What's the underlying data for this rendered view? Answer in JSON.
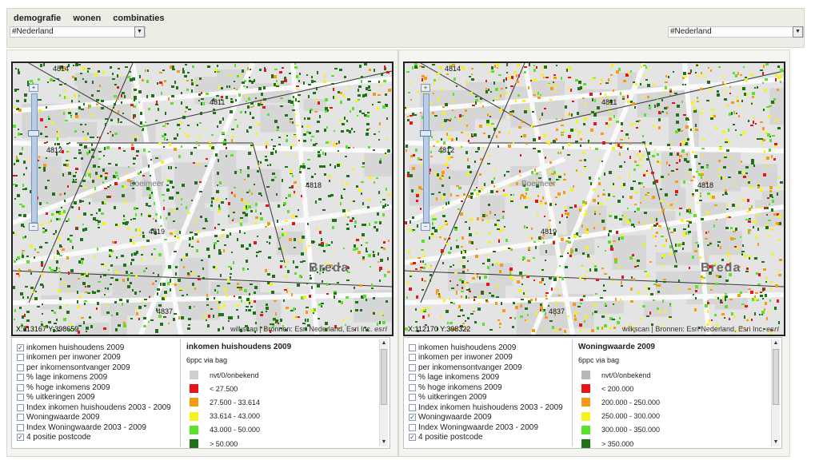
{
  "menu": [
    "demografie",
    "wonen",
    "combinaties"
  ],
  "left_select": "#Nederland",
  "right_select": "#Nederland",
  "left": {
    "coords": "X:113167 Y:398659",
    "attribution": "wilkscan | Bronnen: Esri Nederland, Esri Inc.",
    "esri": "esri",
    "postcodes": [
      "4811",
      "4812",
      "4818",
      "4819",
      "4837",
      "4814"
    ],
    "city": "Breda",
    "district": "Boeimeer",
    "checks": [
      {
        "label": "inkomen huishoudens 2009",
        "checked": true
      },
      {
        "label": "inkomen per inwoner 2009",
        "checked": false
      },
      {
        "label": "per inkomensontvanger 2009",
        "checked": false
      },
      {
        "label": "% lage inkomens 2009",
        "checked": false
      },
      {
        "label": "% hoge inkomens 2009",
        "checked": false
      },
      {
        "label": "% uitkeringen 2009",
        "checked": false
      },
      {
        "label": "Index inkomen huishoudens 2003 - 2009",
        "checked": false
      },
      {
        "label": "Woningwaarde 2009",
        "checked": false
      },
      {
        "label": "Index Woningwaarde 2003 - 2009",
        "checked": false
      },
      {
        "label": "4 positie postcode",
        "checked": true
      }
    ],
    "legend_title": "inkomen huishoudens 2009",
    "legend_sub": "",
    "legend": [
      {
        "label": "nvt/0/onbekend",
        "color": "#cfcfcf"
      },
      {
        "label": "< 27.500",
        "color": "#e8141a"
      },
      {
        "label": "27.500 - 33.614",
        "color": "#f59a12"
      },
      {
        "label": "33.614 - 43.000",
        "color": "#f6f21e"
      },
      {
        "label": "43.000 - 50.000",
        "color": "#58e22a"
      },
      {
        "label": "> 50.000",
        "color": "#1e7318"
      }
    ]
  },
  "right": {
    "coords": "X:112170 Y:398322",
    "attribution": "wilkscan | Bronnen: Esri Nederland, Esri Inc.",
    "esri": "esri",
    "postcodes": [
      "4811",
      "4812",
      "4818",
      "4819",
      "4837",
      "4814"
    ],
    "city": "Breda",
    "district": "Boeimeer",
    "checks": [
      {
        "label": "inkomen huishoudens 2009",
        "checked": false
      },
      {
        "label": "inkomen per inwoner 2009",
        "checked": false
      },
      {
        "label": "per inkomensontvanger 2009",
        "checked": false
      },
      {
        "label": "% lage inkomens 2009",
        "checked": false
      },
      {
        "label": "% hoge inkomens 2009",
        "checked": false
      },
      {
        "label": "% uitkeringen 2009",
        "checked": false
      },
      {
        "label": "Index inkomen huishoudens 2003 - 2009",
        "checked": false
      },
      {
        "label": "Woningwaarde 2009",
        "checked": true
      },
      {
        "label": "Index Woningwaarde 2003 - 2009",
        "checked": false
      },
      {
        "label": "4 positie postcode",
        "checked": true
      }
    ],
    "legend_title": "Woningwaarde 2009",
    "legend_sub": "6ppc via bag",
    "legend": [
      {
        "label": "nvt/0/onbekend",
        "color": "#b8b8b8"
      },
      {
        "label": "< 200.000",
        "color": "#e8141a"
      },
      {
        "label": "200.000 - 250.000",
        "color": "#f59a12"
      },
      {
        "label": "250.000 - 300.000",
        "color": "#f6f21e"
      },
      {
        "label": "300.000 - 350.000",
        "color": "#58e22a"
      },
      {
        "label": "> 350.000",
        "color": "#1e7318"
      }
    ]
  },
  "left_legend_sub": "6ppc via bag",
  "icons": {
    "dropdown": "chevron-down-icon",
    "zoom_in": "plus-icon",
    "zoom_out": "minus-icon",
    "scroll_up": "arrow-up-icon",
    "scroll_down": "arrow-down-icon"
  }
}
